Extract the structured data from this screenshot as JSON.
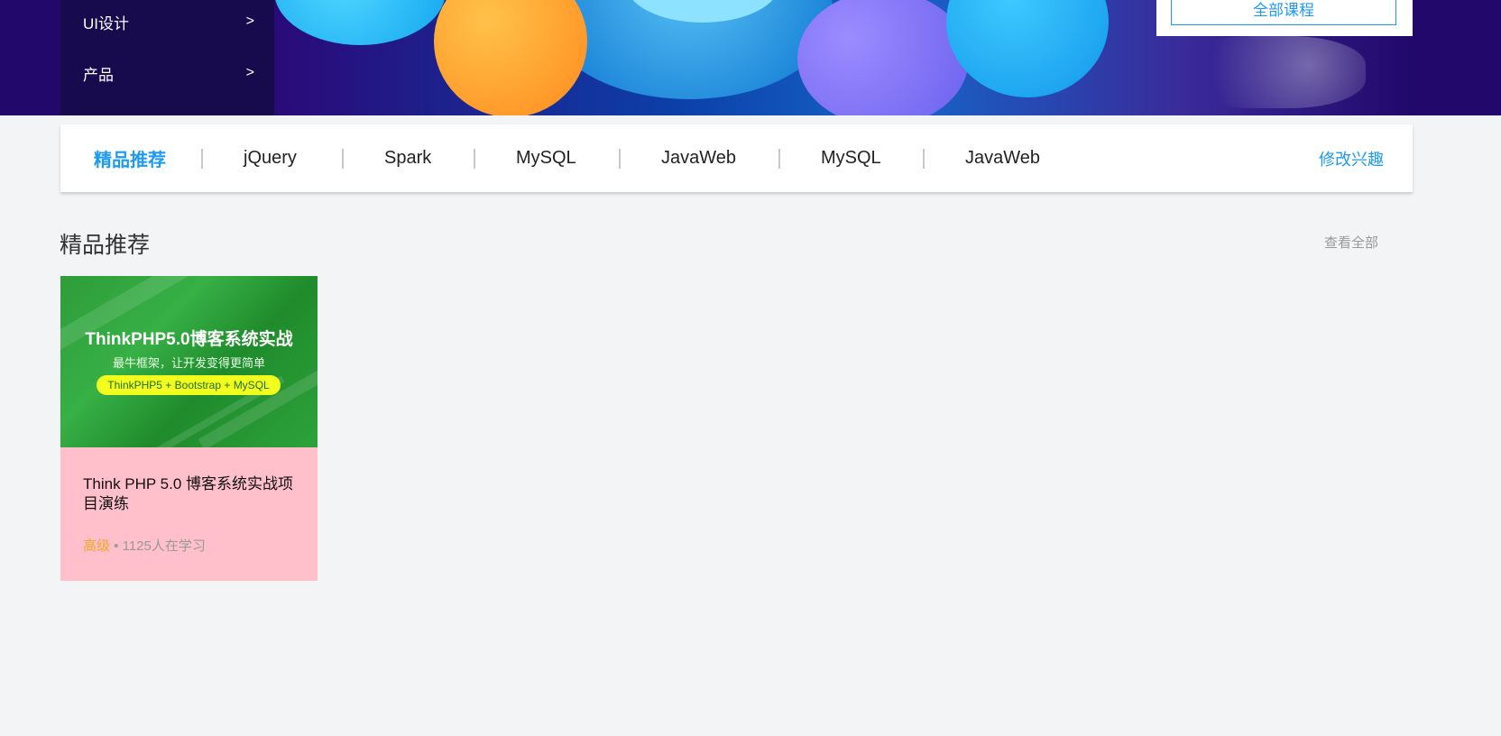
{
  "side_menu": {
    "items": [
      {
        "label": "UI设计",
        "arrow": ">"
      },
      {
        "label": "产品",
        "arrow": ">"
      }
    ]
  },
  "right_panel": {
    "all_courses_label": "全部课程"
  },
  "tabs": {
    "items": [
      {
        "label": "精品推荐",
        "active": true
      },
      {
        "label": "jQuery"
      },
      {
        "label": "Spark"
      },
      {
        "label": "MySQL"
      },
      {
        "label": "JavaWeb"
      },
      {
        "label": "MySQL"
      },
      {
        "label": "JavaWeb"
      }
    ],
    "edit_label": "修改兴趣"
  },
  "section": {
    "title": "精品推荐",
    "view_all": "查看全部"
  },
  "course": {
    "cover_title": "ThinkPHP5.0博客系统实战",
    "cover_subtitle": "最牛框架，让开发变得更简单",
    "cover_pill": "ThinkPHP5 + Bootstrap + MySQL",
    "title": "Think PHP 5.0 博客系统实战项目演练",
    "level": "高级",
    "dot": " • ",
    "learners": "1125人在学习"
  },
  "colors": {
    "accent": "#1e9bf0",
    "level": "#f5a623",
    "banner": "#22086a",
    "card_bg": "#ffc0cb"
  }
}
